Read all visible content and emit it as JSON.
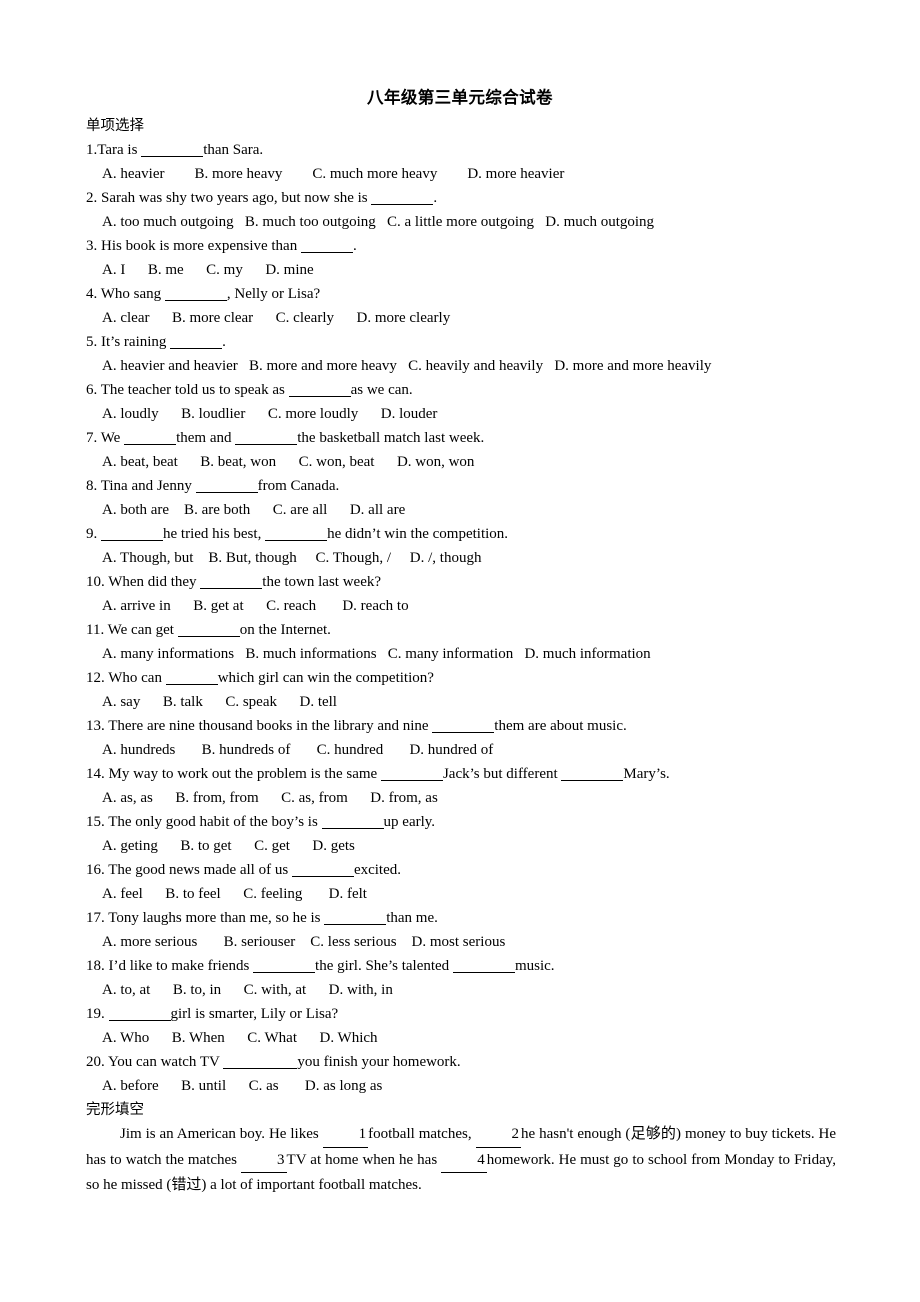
{
  "document": {
    "title": "八年级第三单元综合试卷"
  },
  "sections": [
    {
      "heading": "单项选择",
      "questions": [
        {
          "stem_before": "1.Tara is ",
          "blank": "md",
          "stem_after": "than Sara.",
          "options": "A. heavier        B. more heavy        C. much more heavy        D. more heavier"
        },
        {
          "stem_before": "2. Sarah was shy two years ago, but now she is ",
          "blank": "md",
          "stem_after": ".",
          "options": "A. too much outgoing   B. much too outgoing   C. a little more outgoing   D. much outgoing"
        },
        {
          "stem_before": "3. His book is more expensive than ",
          "blank": "sm",
          "stem_after": ".",
          "options": "A. I      B. me      C. my      D. mine"
        },
        {
          "stem_before": "4. Who sang ",
          "blank": "md",
          "stem_after": ", Nelly or Lisa?",
          "options": "A. clear      B. more clear      C. clearly      D. more clearly"
        },
        {
          "stem_before": "5. It’s raining ",
          "blank": "sm",
          "stem_after": ".",
          "options": "A. heavier and heavier   B. more and more heavy   C. heavily and heavily   D. more and more heavily"
        },
        {
          "stem_before": "6. The teacher told us to speak as ",
          "blank": "md",
          "stem_after": "as we can.",
          "options": "A. loudly      B. loudlier      C. more loudly      D. louder"
        },
        {
          "stem_before": "7. We ",
          "blank": "sm",
          "stem_mid": "them and ",
          "blank2": "md",
          "stem_after": "the basketball match last week.",
          "options": "A. beat, beat      B. beat, won      C. won, beat      D. won, won"
        },
        {
          "stem_before": "8. Tina and Jenny ",
          "blank": "md",
          "stem_after": "from Canada.",
          "options": "A. both are    B. are both      C. are all      D. all are"
        },
        {
          "stem_before": "9. ",
          "blank": "md",
          "stem_after": "he tried his best, ",
          "blank2": "md",
          "stem_tail": "he didn’t win the competition.",
          "options": "A. Though, but    B. But, though     C. Though, /     D. /, though"
        },
        {
          "stem_before": "10. When did they ",
          "blank": "md",
          "stem_after": "the town last week?",
          "options": "A. arrive in      B. get at      C. reach       D. reach to"
        },
        {
          "stem_before": "11. We can get ",
          "blank": "md",
          "stem_after": "on the Internet.",
          "options": "A. many informations   B. much informations   C. many information   D. much information"
        },
        {
          "stem_before": "12. Who can ",
          "blank": "sm",
          "stem_after": "which girl can win the competition?",
          "options": "A. say      B. talk      C. speak      D. tell"
        },
        {
          "stem_before": "13. There are nine thousand books in the library and nine ",
          "blank": "md",
          "stem_after": "them are about music.",
          "options": "A. hundreds       B. hundreds of       C. hundred       D. hundred of"
        },
        {
          "stem_before": "14. My way to work out the problem is the same ",
          "blank": "md",
          "stem_after": "Jack’s but different ",
          "blank2": "md",
          "stem_tail": "Mary’s.",
          "options": "A. as, as      B. from, from      C. as, from      D. from, as"
        },
        {
          "stem_before": "15. The only good habit of the boy’s is ",
          "blank": "md",
          "stem_after": "up early.",
          "options": "A. geting      B. to get      C. get      D. gets"
        },
        {
          "stem_before": "16. The good news made all of us ",
          "blank": "md",
          "stem_after": "excited.",
          "options": "A. feel      B. to feel      C. feeling       D. felt"
        },
        {
          "stem_before": "17. Tony laughs more than me, so he is ",
          "blank": "md",
          "stem_after": "than me.",
          "options": "A. more serious       B. seriouser    C. less serious    D. most serious"
        },
        {
          "stem_before": "18. I’d like to make friends ",
          "blank": "md",
          "stem_after": "the girl. She’s talented ",
          "blank2": "md",
          "stem_tail": "music.",
          "options": "A. to, at      B. to, in      C. with, at      D. with, in"
        },
        {
          "stem_before": "19. ",
          "blank": "md",
          "stem_after": "girl is smarter, Lily or Lisa?",
          "options": "A. Who      B. When      C. What      D. Which"
        },
        {
          "stem_before": "20. You can watch TV ",
          "blank": "md",
          "stem_after": "you finish your homework.",
          "options": "A. before      B. until      C. as       D. as long as"
        }
      ]
    }
  ],
  "cloze": {
    "heading": "完形填空",
    "text_parts": {
      "p1": "Jim is an American boy. He likes ",
      "n1": "1",
      "p2": "football matches, ",
      "n2": "2",
      "p3": "he hasn't enough (足够的) money to buy tickets. He has to watch the matches ",
      "n3": "3",
      "p4": "TV at home when he has ",
      "n4": "4",
      "p5": "homework. He must go to school from Monday to Friday, so he missed (错过) a lot of important football matches."
    }
  }
}
